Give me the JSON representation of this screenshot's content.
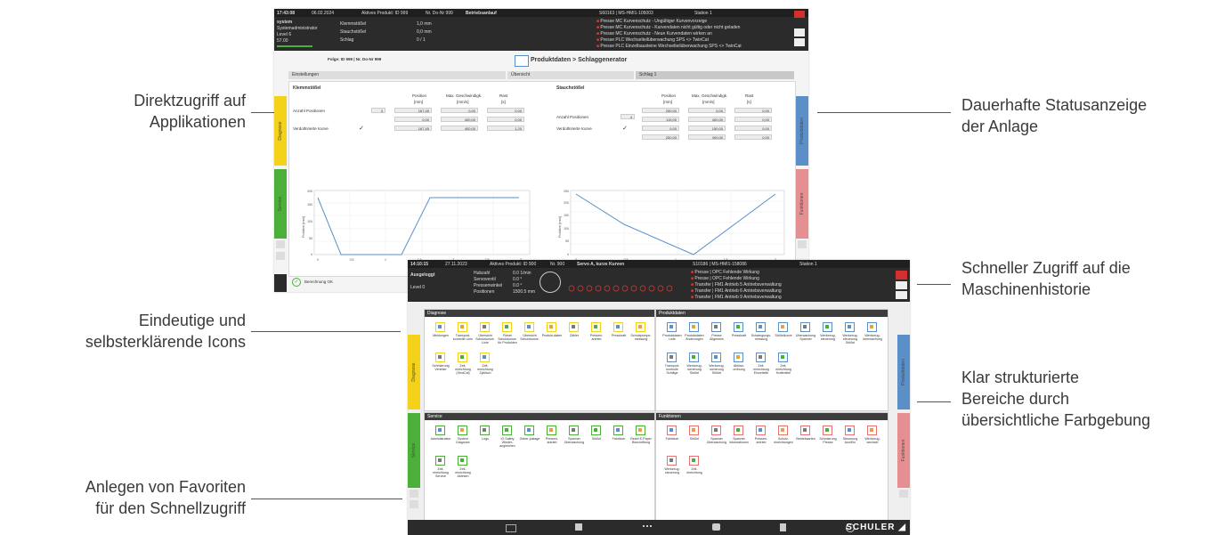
{
  "callouts": {
    "left": [
      "Direktzugriff auf",
      "Applikationen",
      "Eindeutige und",
      "selbsterklärende Icons",
      "Anlegen von Favoriten",
      "für den Schnellzugriff"
    ],
    "right": [
      "Dauerhafte Statusanzeige",
      "der Anlage",
      "Schneller Zugriff auf die",
      "Maschinenhistorie",
      "Klar strukturierte",
      "Bereiche durch",
      "übersichtliche Farbgebung"
    ]
  },
  "screen1": {
    "topbar": {
      "time": "17:43:08",
      "date": "06.02.2024",
      "product": "Aktives Produkt: ID 999",
      "nr": "Nr. Do-Nr 999",
      "mode": "Betriebsanlauf",
      "machine": "S60163 | MS-HMI1-105003",
      "station": "Station 1",
      "user": "system",
      "user_role": "Systemadministrator",
      "level": "Level 6",
      "value": "57.00",
      "fields": [
        "Klemmstößel",
        "Stauchstößel",
        "Schlag"
      ],
      "field_values": [
        "1,0 mm",
        "0,0 mm",
        "0 / 1"
      ],
      "messages": [
        "Presse MC  Kurvenschutz - Ungültiger Kurvenvorzeige",
        "Presse MC  Kurvenschutz - Kurvendaten nicht gültig oder nicht geladen",
        "Presse MC  Kurvenschutz - Neue Kurvendaten wirken an",
        "Presse PLC  Wechselteilüberwachung SPS <> TwinCat",
        "Presse PLC  Einzelbausteine Wechselteilüberwachung SPS <> TwinCat"
      ]
    },
    "breadcrumb": "Folge: ID 999 | Nr. Do-Nr 999",
    "title": "Produktdaten > Schlaggenerator",
    "tabs": [
      "Einstellungen",
      "Übersicht",
      "Schlag 1"
    ],
    "klemm": {
      "title": "Klemmstößel",
      "cols": [
        "Position",
        "Max. Geschwindigk.",
        "Rast"
      ],
      "units": [
        "[mm]",
        "[mm/s]",
        "[s]"
      ],
      "rows": [
        {
          "label": "Anzahl Positionen",
          "extra": "3",
          "vals": [
            "167,45",
            "0,00",
            "0,00"
          ]
        },
        {
          "label": "",
          "extra": "",
          "vals": [
            "0,00",
            "400,00",
            "0,00"
          ]
        },
        {
          "label": "Verdoltnrierte Kurve",
          "extra": "",
          "vals": [
            "167,45",
            "400,00",
            "1,20"
          ]
        }
      ]
    },
    "stauch": {
      "title": "Stauchstößel",
      "cols": [
        "Position",
        "Max. Geschwindigk.",
        "Rast"
      ],
      "units": [
        "[mm]",
        "[mm/s]",
        "[s]"
      ],
      "rows": [
        {
          "label": "Anzahl Positionen",
          "extra": "4",
          "vals": [
            "250,00",
            "0,00",
            "0,00"
          ]
        },
        {
          "label": "",
          "extra": "",
          "vals": [
            "115,00",
            "400,00",
            "0,00"
          ]
        },
        {
          "label": "Verdoltnrierte Kurve",
          "extra": "",
          "vals": [
            "0,00",
            "150,00",
            "0,00"
          ]
        },
        {
          "label": "",
          "extra": "",
          "vals": [
            "250,00",
            "400,00",
            "0,00"
          ]
        }
      ]
    },
    "side_tabs_left": [
      "Diagnose",
      "Service"
    ],
    "side_tabs_right": [
      "Produktdaten",
      "Funktionen"
    ],
    "status": "Berechnung OK",
    "chart1": {
      "ylabel": "Position [mm]",
      "xlabel": "Zeit [s]",
      "yticks": [
        "200",
        "150",
        "100",
        "50",
        "0"
      ],
      "xticks": [
        "0",
        "0.5",
        "1",
        "1.5",
        "2",
        "2.5",
        "3"
      ]
    },
    "chart2": {
      "ylabel": "Position [mm]",
      "xlabel": "Zeit [s]",
      "yticks": [
        "250",
        "200",
        "150",
        "100",
        "50",
        "0"
      ],
      "xticks": [
        "0",
        "0.5",
        "1",
        "1.5",
        "2"
      ]
    }
  },
  "screen2": {
    "topbar": {
      "time": "14:10:15",
      "date": "27.11.2023",
      "product": "Aktives Produkt: ID 900",
      "nr": "Nr. 900",
      "mode": "Servo A, kurze Kurven",
      "machine": "S10186 | MS-HMI1-158086",
      "station": "Station 1",
      "user": "Ausgeloggt",
      "level": "Level 0",
      "fields": [
        "Hubzahl",
        "Servoventil",
        "Pressenwinkel",
        "Positionen"
      ],
      "field_values": [
        "0.0 1/min",
        "0.0 °",
        "0.0 °",
        "1500.5 mm"
      ],
      "messages": [
        "Presse | OPC  Fehlende Wirkung",
        "Presse | OPC  Fehlende Wirkung",
        "Transfer | FM1  Antrieb 5 Antriebsverwaltung",
        "Transfer | FM1  Antrieb 6 Antriebsverwaltung",
        "Transfer | FM1  Antrieb 9 Antriebsverwaltung"
      ]
    },
    "sections": {
      "diagnose": {
        "title": "Diagnose",
        "icons": [
          "Meldungen",
          "Transport-kontrolle Linie",
          "Übersicht Schutzkonze. Linie",
          "Reset Schutzkonze. für Produkten",
          "Übersicht Schutzkonze.",
          "Produkt-daten",
          "Zähler",
          "Pressen-antrieb",
          "Presskraft",
          "Schutzpumpe-messung",
          "Schmierung Verteiler",
          "Zeit-einrichtung (ShotCal)",
          "Zeit-einrichtung Zyklisch"
        ]
      },
      "service": {
        "title": "Service",
        "icons": [
          "Administration",
          "System Diagnose",
          "Logs",
          "IO Safety Wieder-angleichen",
          "Geber-justage",
          "Pressen-antrieb",
          "Spanner Überwachung",
          "Stößel",
          "Fahrtisch",
          "Reset E-Paper Beschriftung",
          "Zeit-einrichtung Service",
          "Zeit-einrichtung Ablesen"
        ]
      },
      "produktdaten": {
        "title": "Produktdaten",
        "icons": [
          "Produktdaten Liste",
          "Produktdaten Änderungen",
          "Presse Allgemein",
          "Presskraft",
          "Schwingungs-messung",
          "Stößelkurve",
          "Überwachung Spanner",
          "Werkzeug-steuerung",
          "Werkzeug-steuerung Stößel",
          "Werkzeug-überwachung",
          "Transport-kontrolle Schläge",
          "Werkzeug-sicherung Stößel",
          "Werkzeug-sicherung Stößel",
          "Ablöse-ordnung",
          "Zeit-einrichtung Einzelteile",
          "Zeit-einrichtung Kraftmittel"
        ]
      },
      "funktionen": {
        "title": "Funktionen",
        "icons": [
          "Fahrtisch",
          "Stößel",
          "Spanner Überwachung",
          "Spanner Informationen",
          "Pressen-antrieb",
          "Schutz-einrichtungen",
          "Betriebsarten",
          "Schmierung Presse",
          "Steuerung Aus/Ein",
          "Werkzeug-wechsel",
          "Werkzeug-steuerung",
          "Zeit-einrichtung"
        ]
      }
    },
    "side_tabs_left": [
      "Diagnose",
      "Service"
    ],
    "side_tabs_right": [
      "Produktdaten",
      "Funktionen"
    ],
    "brand": "SCHULER"
  }
}
